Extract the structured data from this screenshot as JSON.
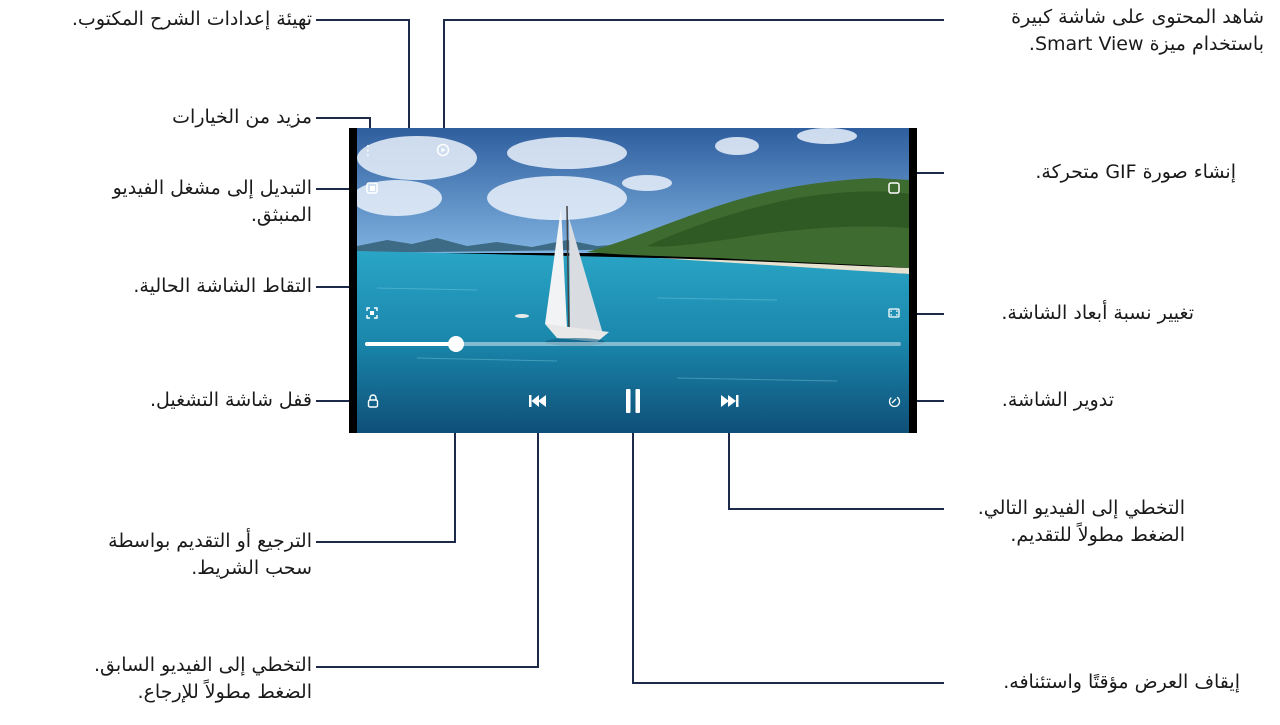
{
  "labels": {
    "captions_settings": "تهيئة إعدادات الشرح المكتوب.",
    "more_options": "مزيد من الخيارات",
    "switch_popup": "التبديل إلى مشغل الفيديو\nالمنبثق.",
    "capture_screen": "التقاط الشاشة الحالية.",
    "lock_screen": "قفل شاشة التشغيل.",
    "seek_bar": "الترجيع أو التقديم بواسطة\nسحب الشريط.",
    "previous_video": "التخطي إلى الفيديو السابق.\nالضغط مطولاً للإرجاع.",
    "smart_view": "شاهد المحتوى على شاشة كبيرة\nباستخدام ميزة Smart View.",
    "create_gif": "إنشاء صورة GIF متحركة.",
    "aspect_ratio": "تغيير نسبة أبعاد الشاشة.",
    "rotate_screen": "تدوير الشاشة.",
    "next_video": "التخطي إلى الفيديو التالي.\nالضغط مطولاً للتقديم.",
    "pause_resume": "إيقاف العرض مؤقتًا واستئنافه."
  },
  "player": {
    "progress": 0.17,
    "state": "playing",
    "icons": [
      "more-options-icon",
      "captions-icon",
      "smart-view-icon",
      "popup-player-icon",
      "gif-icon",
      "capture-icon",
      "aspect-ratio-icon",
      "lock-icon",
      "rotate-icon",
      "previous-icon",
      "pause-icon",
      "next-icon"
    ]
  },
  "colors": {
    "callout_line": "#1e2a4a",
    "sky": "#5b8fd0",
    "sea": "#1b8fb0"
  }
}
